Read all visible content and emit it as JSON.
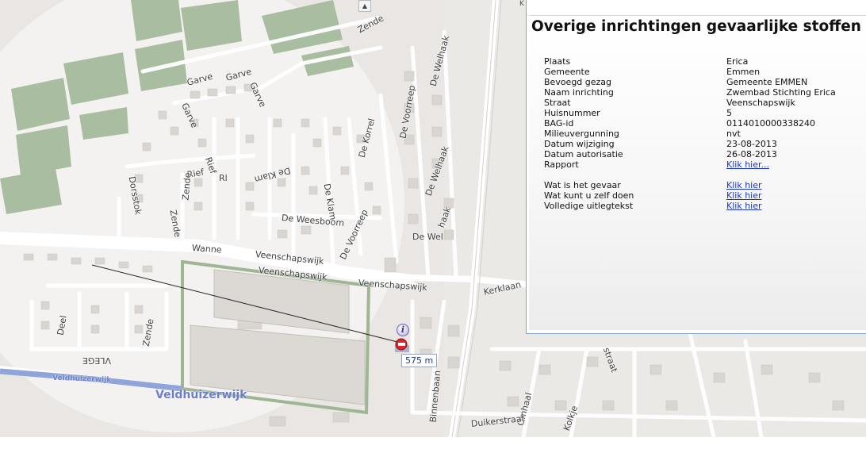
{
  "map": {
    "streets": [
      {
        "id": "zende-top",
        "text": "Zende"
      },
      {
        "id": "garve-1",
        "text": "Garve"
      },
      {
        "id": "garve-2",
        "text": "Garve"
      },
      {
        "id": "garve-3",
        "text": "Garve"
      },
      {
        "id": "garve-4",
        "text": "Garve"
      },
      {
        "id": "de-welhaak-1",
        "text": "De Welhaak"
      },
      {
        "id": "de-voorreep-1",
        "text": "De Voorreep"
      },
      {
        "id": "de-korrel",
        "text": "De Korrel"
      },
      {
        "id": "de-welhaak-2",
        "text": "De Welhaak"
      },
      {
        "id": "rief-1",
        "text": "Rief"
      },
      {
        "id": "rief-2",
        "text": "Rief"
      },
      {
        "id": "rl",
        "text": "Rl"
      },
      {
        "id": "de-klam-1",
        "text": "De Klam"
      },
      {
        "id": "de-klam-2",
        "text": "De Klam"
      },
      {
        "id": "dorsstok",
        "text": "Dorsstok"
      },
      {
        "id": "zende-2",
        "text": "Zende"
      },
      {
        "id": "zende-3",
        "text": "Zende"
      },
      {
        "id": "de-weesboom",
        "text": "De Weesboom"
      },
      {
        "id": "de-voorreep-2",
        "text": "De Voorreep"
      },
      {
        "id": "de-welhaak-3",
        "text": "De Wel"
      },
      {
        "id": "de-welhaak-4",
        "text": "haak"
      },
      {
        "id": "wanne",
        "text": "Wanne"
      },
      {
        "id": "veenschapswijk-1",
        "text": "Veenschapswijk"
      },
      {
        "id": "veenschapswijk-2",
        "text": "Veenschapswijk"
      },
      {
        "id": "veenschapswijk-3",
        "text": "Veenschapswijk"
      },
      {
        "id": "kerklaan",
        "text": "Kerklaan"
      },
      {
        "id": "deel",
        "text": "Deel"
      },
      {
        "id": "zende-4",
        "text": "Zende"
      },
      {
        "id": "vlege",
        "text": "VLEGE"
      },
      {
        "id": "binnenbaan",
        "text": "Binnenbaan"
      },
      {
        "id": "omhaal",
        "text": "Omhaal"
      },
      {
        "id": "kolkje",
        "text": "Kolkje"
      },
      {
        "id": "duikerstraat",
        "text": "Duikerstraat"
      },
      {
        "id": "straat",
        "text": "straat"
      }
    ],
    "water": [
      {
        "id": "veldhuizerwijk-small",
        "text": "Veldhuizerwijk"
      },
      {
        "id": "veldhuizerwijk-large",
        "text": "Veldhuizerwijk"
      }
    ],
    "distance_label": "575 m",
    "info_badge": "i",
    "scroll_up_glyph": "▲",
    "corner_glyph": "K",
    "colors": {
      "background": "#e9e6e3",
      "buffer": "#f3f2f1",
      "block": "#d7d3cf",
      "green": "#9db38f",
      "water": "#8fa4d8",
      "road": "#ffffff",
      "marker": "#e0222a"
    }
  },
  "popup": {
    "title": "Overige inrichtingen gevaarlijke stoffen",
    "rows": [
      {
        "key": "Plaats",
        "value": "Erica"
      },
      {
        "key": "Gemeente",
        "value": "Emmen"
      },
      {
        "key": "Bevoegd gezag",
        "value": "Gemeente EMMEN"
      },
      {
        "key": "Naam inrichting",
        "value": "Zwembad Stichting Erica"
      },
      {
        "key": "Straat",
        "value": "Veenschapswijk"
      },
      {
        "key": "Huisnummer",
        "value": "5"
      },
      {
        "key": "BAG-id",
        "value": "0114010000338240"
      },
      {
        "key": "Milieuvergunning",
        "value": "nvt"
      },
      {
        "key": "Datum wijziging",
        "value": "23-08-2013"
      },
      {
        "key": "Datum autorisatie",
        "value": "26-08-2013"
      },
      {
        "key": "Rapport",
        "value": "Klik hier..."
      }
    ],
    "links": [
      {
        "key": "Wat is het gevaar",
        "value": "Klik hier"
      },
      {
        "key": "Wat kunt u zelf doen",
        "value": "Klik hier"
      },
      {
        "key": "Volledige uitlegtekst",
        "value": "Klik hier"
      }
    ]
  }
}
